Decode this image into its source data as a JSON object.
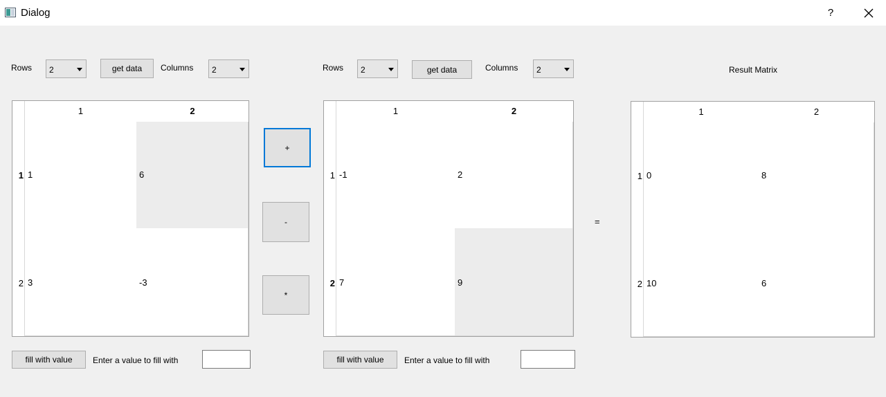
{
  "window": {
    "title": "Dialog",
    "help_label": "?"
  },
  "left": {
    "rows_label": "Rows",
    "rows_value": "2",
    "get_data_label": "get data",
    "columns_label": "Columns",
    "columns_value": "2",
    "col_headers": [
      "1",
      "2"
    ],
    "row_headers": [
      "1",
      "2"
    ],
    "cells": [
      [
        "1",
        "6"
      ],
      [
        "3",
        "-3"
      ]
    ],
    "fill_button_label": "fill with value",
    "fill_prompt": "Enter a value to fill with",
    "fill_value": ""
  },
  "right": {
    "rows_label": "Rows",
    "rows_value": "2",
    "get_data_label": "get data",
    "columns_label": "Columns",
    "columns_value": "2",
    "col_headers": [
      "1",
      "2"
    ],
    "row_headers": [
      "1",
      "2"
    ],
    "cells": [
      [
        "-1",
        "2"
      ],
      [
        "7",
        "9"
      ]
    ],
    "fill_button_label": "fill with value",
    "fill_prompt": "Enter a value to fill with",
    "fill_value": ""
  },
  "operations": {
    "add": "+",
    "subtract": "-",
    "multiply": "*"
  },
  "equals_sign": "=",
  "result": {
    "title": "Result Matrix",
    "col_headers": [
      "1",
      "2"
    ],
    "row_headers": [
      "1",
      "2"
    ],
    "cells": [
      [
        "0",
        "8"
      ],
      [
        "10",
        "6"
      ]
    ]
  },
  "colors": {
    "focus_border": "#0078d7",
    "selected_cell": "#ececec"
  }
}
